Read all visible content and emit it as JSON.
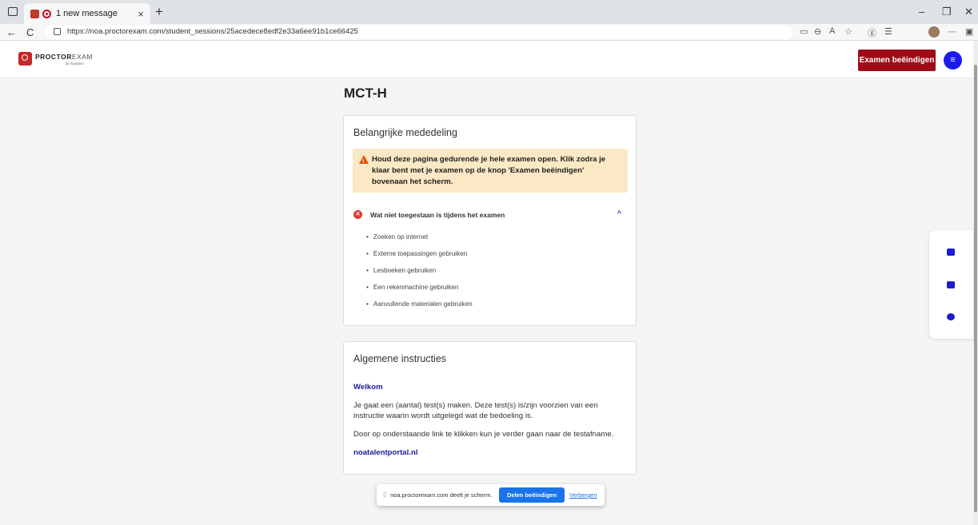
{
  "browser": {
    "tab_title": "1 new message",
    "tab_close": "×",
    "new_tab": "+",
    "url": "https://noa.proctorexam.com/student_sessions/25acedece8edf2e33a6ee91b1ce66425",
    "window_controls": [
      "–",
      "❐",
      "✕"
    ],
    "nav_back": "←",
    "nav_refresh": "C",
    "tools": [
      "▭",
      "⊖",
      "A",
      "☆",
      "ⓖ",
      "☰",
      "⋯",
      "▣"
    ]
  },
  "header": {
    "logo_bold": "PROCTOR",
    "logo_light": "EXAM",
    "logo_sub": "by Surpass",
    "end_exam_label": "Examen beëindigen",
    "menu_icon": "≡"
  },
  "main": {
    "title": "MCT-H",
    "notice_card": {
      "title": "Belangrijke mededeling",
      "warning_text": "Houd deze pagina gedurende je hele examen open. Klik zodra je klaar bent met je examen op de knop 'Examen beëindigen' bovenaan het scherm.",
      "accordion_title": "Wat niet toegestaan is tijdens het examen",
      "accordion_chevron": "^",
      "items": [
        "Zoeken op internet",
        "Externe toepassingen gebruiken",
        "Lesboeken gebruiken",
        "Een rekenmachine gebruiken",
        "Aanvullende materialen gebruiken"
      ]
    },
    "instructions_card": {
      "title": "Algemene instructies",
      "welcome": "Welkom",
      "paragraph1": "Je gaat een (aantal) test(s) maken. Deze test(s) is/zijn voorzien van een instructie waarin wordt uitgelegd wat de bedoeling is.",
      "paragraph2": "Door op onderstaande link te klikken kun je verder gaan naar de testafname.",
      "link": "noatalentportal.nl"
    }
  },
  "share_bar": {
    "grip": "||",
    "text": "noa.proctorexam.com deelt je scherm.",
    "stop_label": "Delen beëindigen",
    "hide_label": "Verbergen"
  },
  "colors": {
    "accent_red": "#9e0b16",
    "accent_blue": "#1b1bf0",
    "warning_bg": "#fbe8c5",
    "link_blue": "#1a1a9e"
  },
  "icons": {
    "side_tools": [
      "screen-share-icon",
      "camera-icon",
      "help-icon"
    ]
  }
}
